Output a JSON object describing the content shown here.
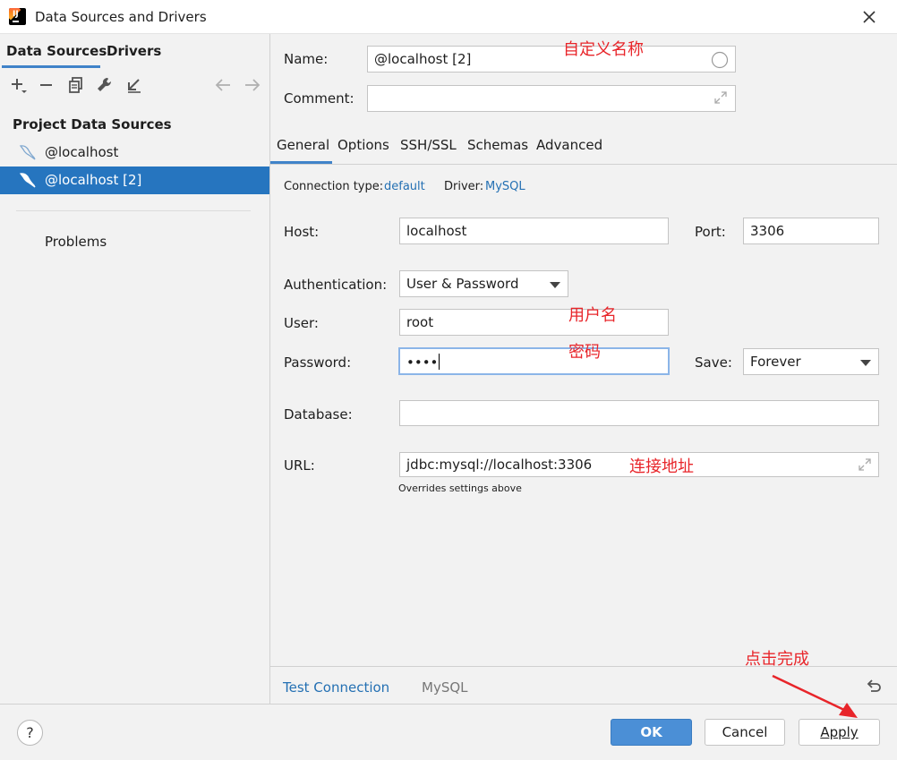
{
  "window": {
    "title": "Data Sources and Drivers",
    "icon": "intellij-app-icon",
    "close": "close-icon",
    "app_badge": "IJ"
  },
  "sidebar": {
    "tabs": [
      {
        "label": "Data Sources",
        "active": true
      },
      {
        "label": "Drivers",
        "active": false
      }
    ],
    "toolbar": [
      "add-icon",
      "remove-icon",
      "duplicate-icon",
      "wrench-icon",
      "import-icon",
      "arrow-left-icon",
      "arrow-right-icon"
    ],
    "section_title": "Project Data Sources",
    "items": [
      {
        "label": "@localhost",
        "selected": false,
        "icon": "mysql-icon"
      },
      {
        "label": "@localhost [2]",
        "selected": true,
        "icon": "mysql-icon"
      }
    ],
    "problems": "Problems"
  },
  "form": {
    "name_label": "Name:",
    "name_value": "@localhost [2]",
    "comment_label": "Comment:",
    "comment_value": "",
    "tabs": [
      "General",
      "Options",
      "SSH/SSL",
      "Schemas",
      "Advanced"
    ],
    "active_tab": "General",
    "connection_type_label": "Connection type:",
    "connection_type_value": "default",
    "driver_label": "Driver:",
    "driver_value": "MySQL",
    "host_label": "Host:",
    "host_value": "localhost",
    "port_label": "Port:",
    "port_value": "3306",
    "auth_label": "Authentication:",
    "auth_value": "User & Password",
    "user_label": "User:",
    "user_value": "root",
    "password_label": "Password:",
    "password_value": "••••",
    "save_label": "Save:",
    "save_value": "Forever",
    "database_label": "Database:",
    "database_value": "",
    "url_label": "URL:",
    "url_value": "jdbc:mysql://localhost:3306",
    "url_hint": "Overrides settings above",
    "test_connection": "Test Connection",
    "driver_footer": "MySQL"
  },
  "annotations": {
    "name_note": "自定义名称",
    "user_note": "用户名",
    "password_note": "密码",
    "url_note": "连接地址",
    "apply_note": "点击完成",
    "color": "#e8252a"
  },
  "footer": {
    "help": "?",
    "ok": "OK",
    "cancel": "Cancel",
    "apply": "Apply"
  },
  "colors": {
    "accent": "#4083c9",
    "selection": "#2675bf",
    "link": "#2470b3",
    "primary_button": "#4b8fd6"
  }
}
